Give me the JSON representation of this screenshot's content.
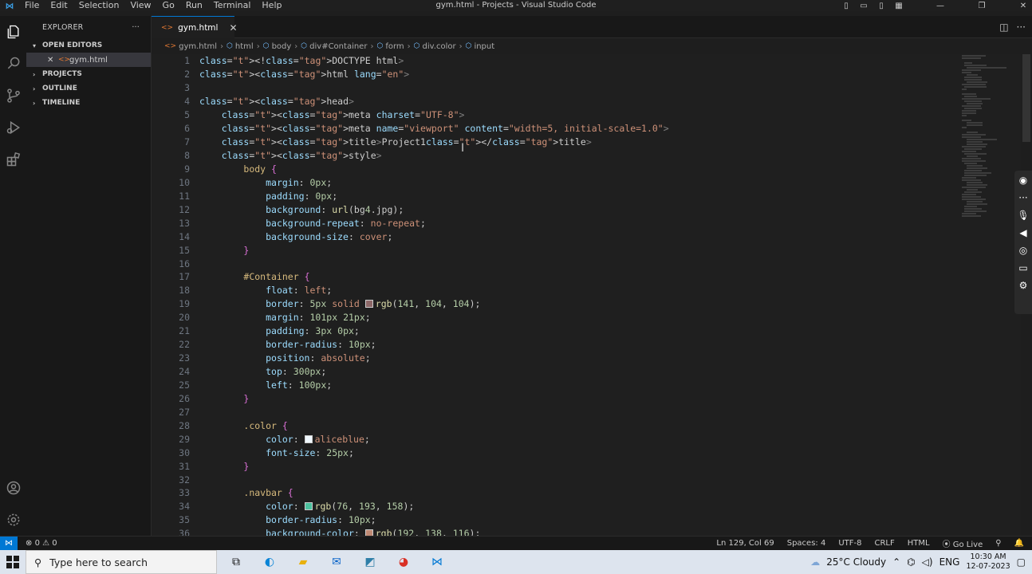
{
  "titlebar": {
    "menu": [
      "File",
      "Edit",
      "Selection",
      "View",
      "Go",
      "Run",
      "Terminal",
      "Help"
    ],
    "window_title": "gym.html - Projects - Visual Studio Code"
  },
  "sidebar": {
    "title": "EXPLORER",
    "more": "···",
    "sections": {
      "open_editors": "OPEN EDITORS",
      "projects": "PROJECTS",
      "outline": "OUTLINE",
      "timeline": "TIMELINE"
    },
    "open_file": "gym.html"
  },
  "tab": {
    "label": "gym.html"
  },
  "breadcrumb": [
    "gym.html",
    "html",
    "body",
    "div#Container",
    "form",
    "div.color",
    "input"
  ],
  "editor": {
    "line_numbers": [
      "1",
      "2",
      "3",
      "4",
      "5",
      "6",
      "7",
      "8",
      "9",
      "10",
      "11",
      "12",
      "13",
      "14",
      "15",
      "16",
      "17",
      "18",
      "19",
      "20",
      "21",
      "22",
      "23",
      "24",
      "25",
      "26",
      "27",
      "28",
      "29",
      "30",
      "31",
      "32",
      "33",
      "34",
      "35",
      "36"
    ],
    "lines": [
      "<!DOCTYPE html>",
      "<html lang=\"en\">",
      "",
      "<head>",
      "    <meta charset=\"UTF-8\">",
      "    <meta name=\"viewport\" content=\"width=5, initial-scale=1.0\">",
      "    <title>Project1</title>",
      "    <style>",
      "        body {",
      "            margin: 0px;",
      "            padding: 0px;",
      "            background: url(bg4.jpg);",
      "            background-repeat: no-repeat;",
      "            background-size: cover;",
      "        }",
      "",
      "        #Container {",
      "            float: left;",
      "            border: 5px solid rgb(141, 104, 104);",
      "            margin: 101px 21px;",
      "            padding: 3px 0px;",
      "            border-radius: 10px;",
      "            position: absolute;",
      "            top: 300px;",
      "            left: 100px;",
      "        }",
      "",
      "        .color {",
      "            color: aliceblue;",
      "            font-size: 25px;",
      "        }",
      "",
      "        .navbar {",
      "            color: rgb(76, 193, 158);",
      "            border-radius: 10px;",
      "            background-color: rgb(192, 138, 116);"
    ],
    "swatches": {
      "border": "#8d6868",
      "aliceblue": "#f0f8ff",
      "navbar_color": "#4cc19e",
      "navbar_bg": "#c08a74"
    }
  },
  "statusbar": {
    "problems": "0",
    "warnings": "0",
    "position": "Ln 129, Col 69",
    "spaces": "Spaces: 4",
    "encoding": "UTF-8",
    "eol": "CRLF",
    "language": "HTML",
    "golive": "Go Live"
  },
  "taskbar": {
    "search_placeholder": "Type here to search",
    "weather": "25°C  Cloudy",
    "lang": "ENG",
    "time": "10:30 AM",
    "date": "12-07-2023"
  },
  "colors": {
    "accent": "#0078d4",
    "editor_bg": "#1f1f1f",
    "sidebar_bg": "#181818"
  }
}
